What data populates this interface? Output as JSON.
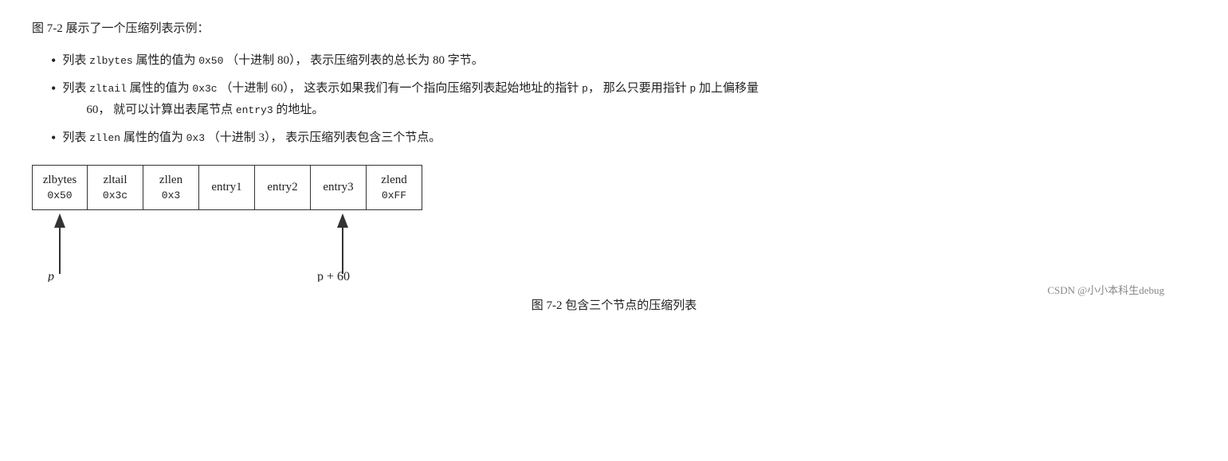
{
  "page": {
    "intro_title": "图 7-2 展示了一个压缩列表示例：",
    "bullets": [
      {
        "id": "bullet1",
        "text_parts": [
          {
            "type": "text",
            "content": "列表 "
          },
          {
            "type": "code",
            "content": "zlbytes"
          },
          {
            "type": "text",
            "content": " 属性的值为 "
          },
          {
            "type": "code",
            "content": "0x50"
          },
          {
            "type": "text",
            "content": " （十进制 "
          },
          {
            "type": "inline",
            "content": "80"
          },
          {
            "type": "text",
            "content": "）， 表示压缩列表的总长为 "
          },
          {
            "type": "inline",
            "content": "80"
          },
          {
            "type": "text",
            "content": " 字节。"
          }
        ]
      },
      {
        "id": "bullet2",
        "text_parts": [
          {
            "type": "text",
            "content": "列表 "
          },
          {
            "type": "code",
            "content": "zltail"
          },
          {
            "type": "text",
            "content": " 属性的值为 "
          },
          {
            "type": "code",
            "content": "0x3c"
          },
          {
            "type": "text",
            "content": " （十进制 "
          },
          {
            "type": "inline",
            "content": "60"
          },
          {
            "type": "text",
            "content": "）， 这表示如果我们有一个指向压缩列表起始地址的指针 "
          },
          {
            "type": "code_inline",
            "content": "p"
          },
          {
            "type": "text",
            "content": "， 那么只要用指针 "
          },
          {
            "type": "code_inline",
            "content": "p"
          },
          {
            "type": "text",
            "content": " 加上偏移量"
          }
        ],
        "continuation": "60， 就可以计算出表尾节点 entry3 的地址。"
      },
      {
        "id": "bullet3",
        "text_parts": [
          {
            "type": "text",
            "content": "列表 "
          },
          {
            "type": "code",
            "content": "zllen"
          },
          {
            "type": "text",
            "content": " 属性的值为 "
          },
          {
            "type": "code",
            "content": "0x3"
          },
          {
            "type": "text",
            "content": " （十进制 "
          },
          {
            "type": "inline",
            "content": "3"
          },
          {
            "type": "text",
            "content": "）， 表示压缩列表包含三个节点。"
          }
        ]
      }
    ],
    "table": {
      "cells": [
        {
          "label": "zlbytes",
          "value": "0x50"
        },
        {
          "label": "zltail",
          "value": "0x3c"
        },
        {
          "label": "zllen",
          "value": "0x3"
        },
        {
          "label": "entry1",
          "value": ""
        },
        {
          "label": "entry2",
          "value": ""
        },
        {
          "label": "entry3",
          "value": ""
        },
        {
          "label": "zlend",
          "value": "0xFF"
        }
      ]
    },
    "arrow_p_label": "p",
    "arrow_p60_label": "p + 60",
    "figure_caption": "图 7-2   包含三个节点的压缩列表",
    "watermark": "CSDN @小小本科生debug"
  }
}
